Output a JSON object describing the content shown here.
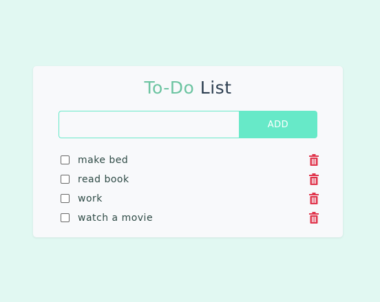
{
  "app": {
    "title_accent": "To-Do",
    "title_rest": "List"
  },
  "form": {
    "input_value": "",
    "input_placeholder": "",
    "add_label": "ADD"
  },
  "todos": [
    {
      "label": "make bed",
      "checked": false
    },
    {
      "label": "read book",
      "checked": false
    },
    {
      "label": "work",
      "checked": false
    },
    {
      "label": "watch a movie",
      "checked": false
    }
  ],
  "colors": {
    "background": "#e1f8f2",
    "card": "#f8f9fb",
    "accent": "#6cc4a1",
    "button": "#67e9c8",
    "title_dark": "#2c3e50",
    "delete": "#e0344b"
  },
  "icons": {
    "delete": "trash-icon"
  }
}
